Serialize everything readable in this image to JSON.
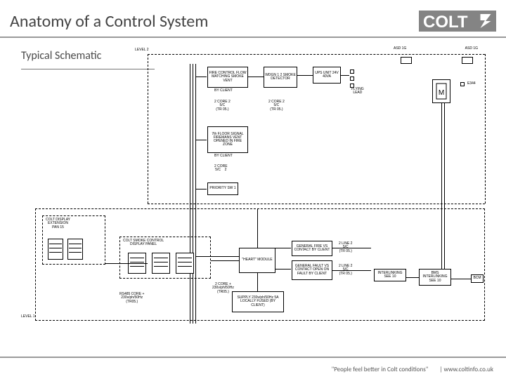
{
  "header": {
    "title": "Anatomy of a Control System",
    "subtitle": "Typical Schematic",
    "logo_text": "COLT"
  },
  "footer": {
    "tagline": "\"People feel better in Colt conditions\"",
    "url": "| www.coltinfo.co.uk"
  },
  "schematic": {
    "frame_left_tl": "LEVEL 2",
    "frame_left_bl": "LEVEL 1",
    "asd_left": "ASD 1G",
    "asd_right": "ASD 1G",
    "top_box1": "FIRE CONTROL\nFLOW MATCHING\nSMOKE VENT",
    "top_box1b": "BY CLIENT",
    "top_lbl1": "2 CORE 2\n5/C\n(TR 05.)",
    "top_box2": "WDGN 1 2\nSMOKE\nDETECTOR",
    "top_lbl2": "2 CORE 2\n5/C\n(TR 05.)",
    "top_box3": "UPS UNIT\n24V 40VA",
    "top_lbl3": "FLYING\nLEAD",
    "mid_box1": "7th FLOOR\nSIGNAL\nFIREMANS VENT\nOPENED IN FIRE\nZONE",
    "mid_box1b": "BY CLIENT",
    "mid_lbl1": "2 CORE\n5/C    2",
    "mid_box2": "PRIORITY\nSW 1",
    "display_ext": "COLT DISPLAY\nEXTENSION\nPAN 15",
    "smoke_panel": "COLT SMOKE CONTROL\nDISPLAY PANEL",
    "heart": "\"HEART\"\nMODULE",
    "heart_r1": "GENERAL FIRE\nVS CONTACT\nBY CLIENT",
    "heart_r2": "GENERAL FAULT\nVS CONTACT\nOPEN ON FAULT\nBY CLIENT",
    "heart_r1_lbl": "2 LINE 2\n5/C\n(TR 05.)",
    "heart_r2_lbl": "2 LINE 2\n5/C\n(TR 05.)",
    "inter_a": "INTERLINKING\nSEE 10",
    "inter_b": "BMS\nINTERLINKING\nSEE 10",
    "bottom_lbl_left": "RS485 CORE +\n230v/ph/50Hz\n(TR05.)",
    "bottom_lbl_mid": "2 CORE +\n230v/ph/50Hz\n(TR05.)",
    "supply": "SUPPLY\n230v/ph/50Hz\n5A LOCALLY FUSED\n(BY CLIENT)",
    "bcm": "BCM"
  }
}
